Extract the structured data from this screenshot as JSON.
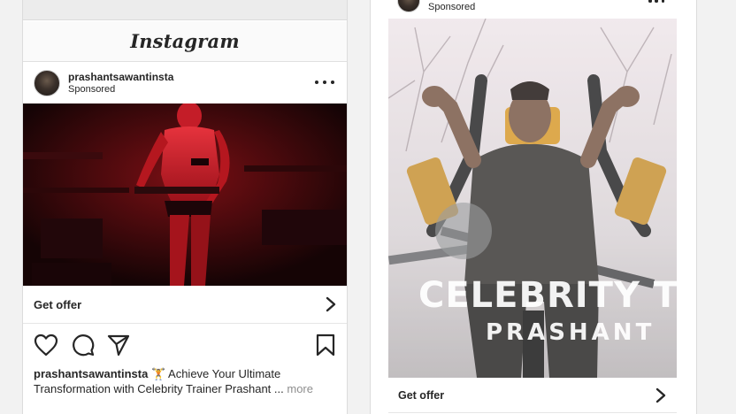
{
  "feed_post": {
    "brand": "Instagram",
    "username": "prashantsawantinsta",
    "sponsored_label": "Sponsored",
    "cta_label": "Get offer",
    "caption": {
      "username": "prashantsawantinsta",
      "emoji": "🏋️",
      "text": " Achieve Your Ultimate Transformation with Celebrity Trainer Prashant ...",
      "more": "more"
    }
  },
  "story_post": {
    "sponsored_label": "Sponsored",
    "overlay_line1": "CELEBRITY T",
    "overlay_line2": "PRASHANT",
    "cta_label": "Get offer"
  },
  "colors": {
    "text": "#262626",
    "muted": "#8e8e8e",
    "media_left_tint": "#b0141c",
    "border": "#dbdbdb"
  },
  "icons": [
    "more-icon",
    "heart-icon",
    "comment-icon",
    "share-icon",
    "bookmark-icon",
    "chevron-right-icon"
  ]
}
